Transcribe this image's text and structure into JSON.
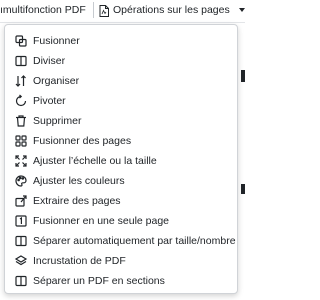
{
  "tabs": {
    "left_label": "ımultifonction PDF",
    "right_label": "Opérations sur les pages"
  },
  "menu": {
    "items": [
      {
        "label": "Fusionner",
        "icon": "merge-icon"
      },
      {
        "label": "Diviser",
        "icon": "split-icon"
      },
      {
        "label": "Organiser",
        "icon": "sort-icon"
      },
      {
        "label": "Pivoter",
        "icon": "rotate-icon"
      },
      {
        "label": "Supprimer",
        "icon": "delete-icon"
      },
      {
        "label": "Fusionner des pages",
        "icon": "grid-icon"
      },
      {
        "label": "Ajuster l’échelle ou la taille",
        "icon": "fullscreen-icon"
      },
      {
        "label": "Ajuster les couleurs",
        "icon": "palette-icon"
      },
      {
        "label": "Extraire des pages",
        "icon": "extract-icon"
      },
      {
        "label": "Fusionner en une seule page",
        "icon": "one-page-icon"
      },
      {
        "label": "Séparer automatiquement par taille/nombre",
        "icon": "auto-split-icon"
      },
      {
        "label": "Incrustation de PDF",
        "icon": "layers-icon"
      },
      {
        "label": "Séparer un PDF en sections",
        "icon": "sections-icon"
      }
    ]
  }
}
